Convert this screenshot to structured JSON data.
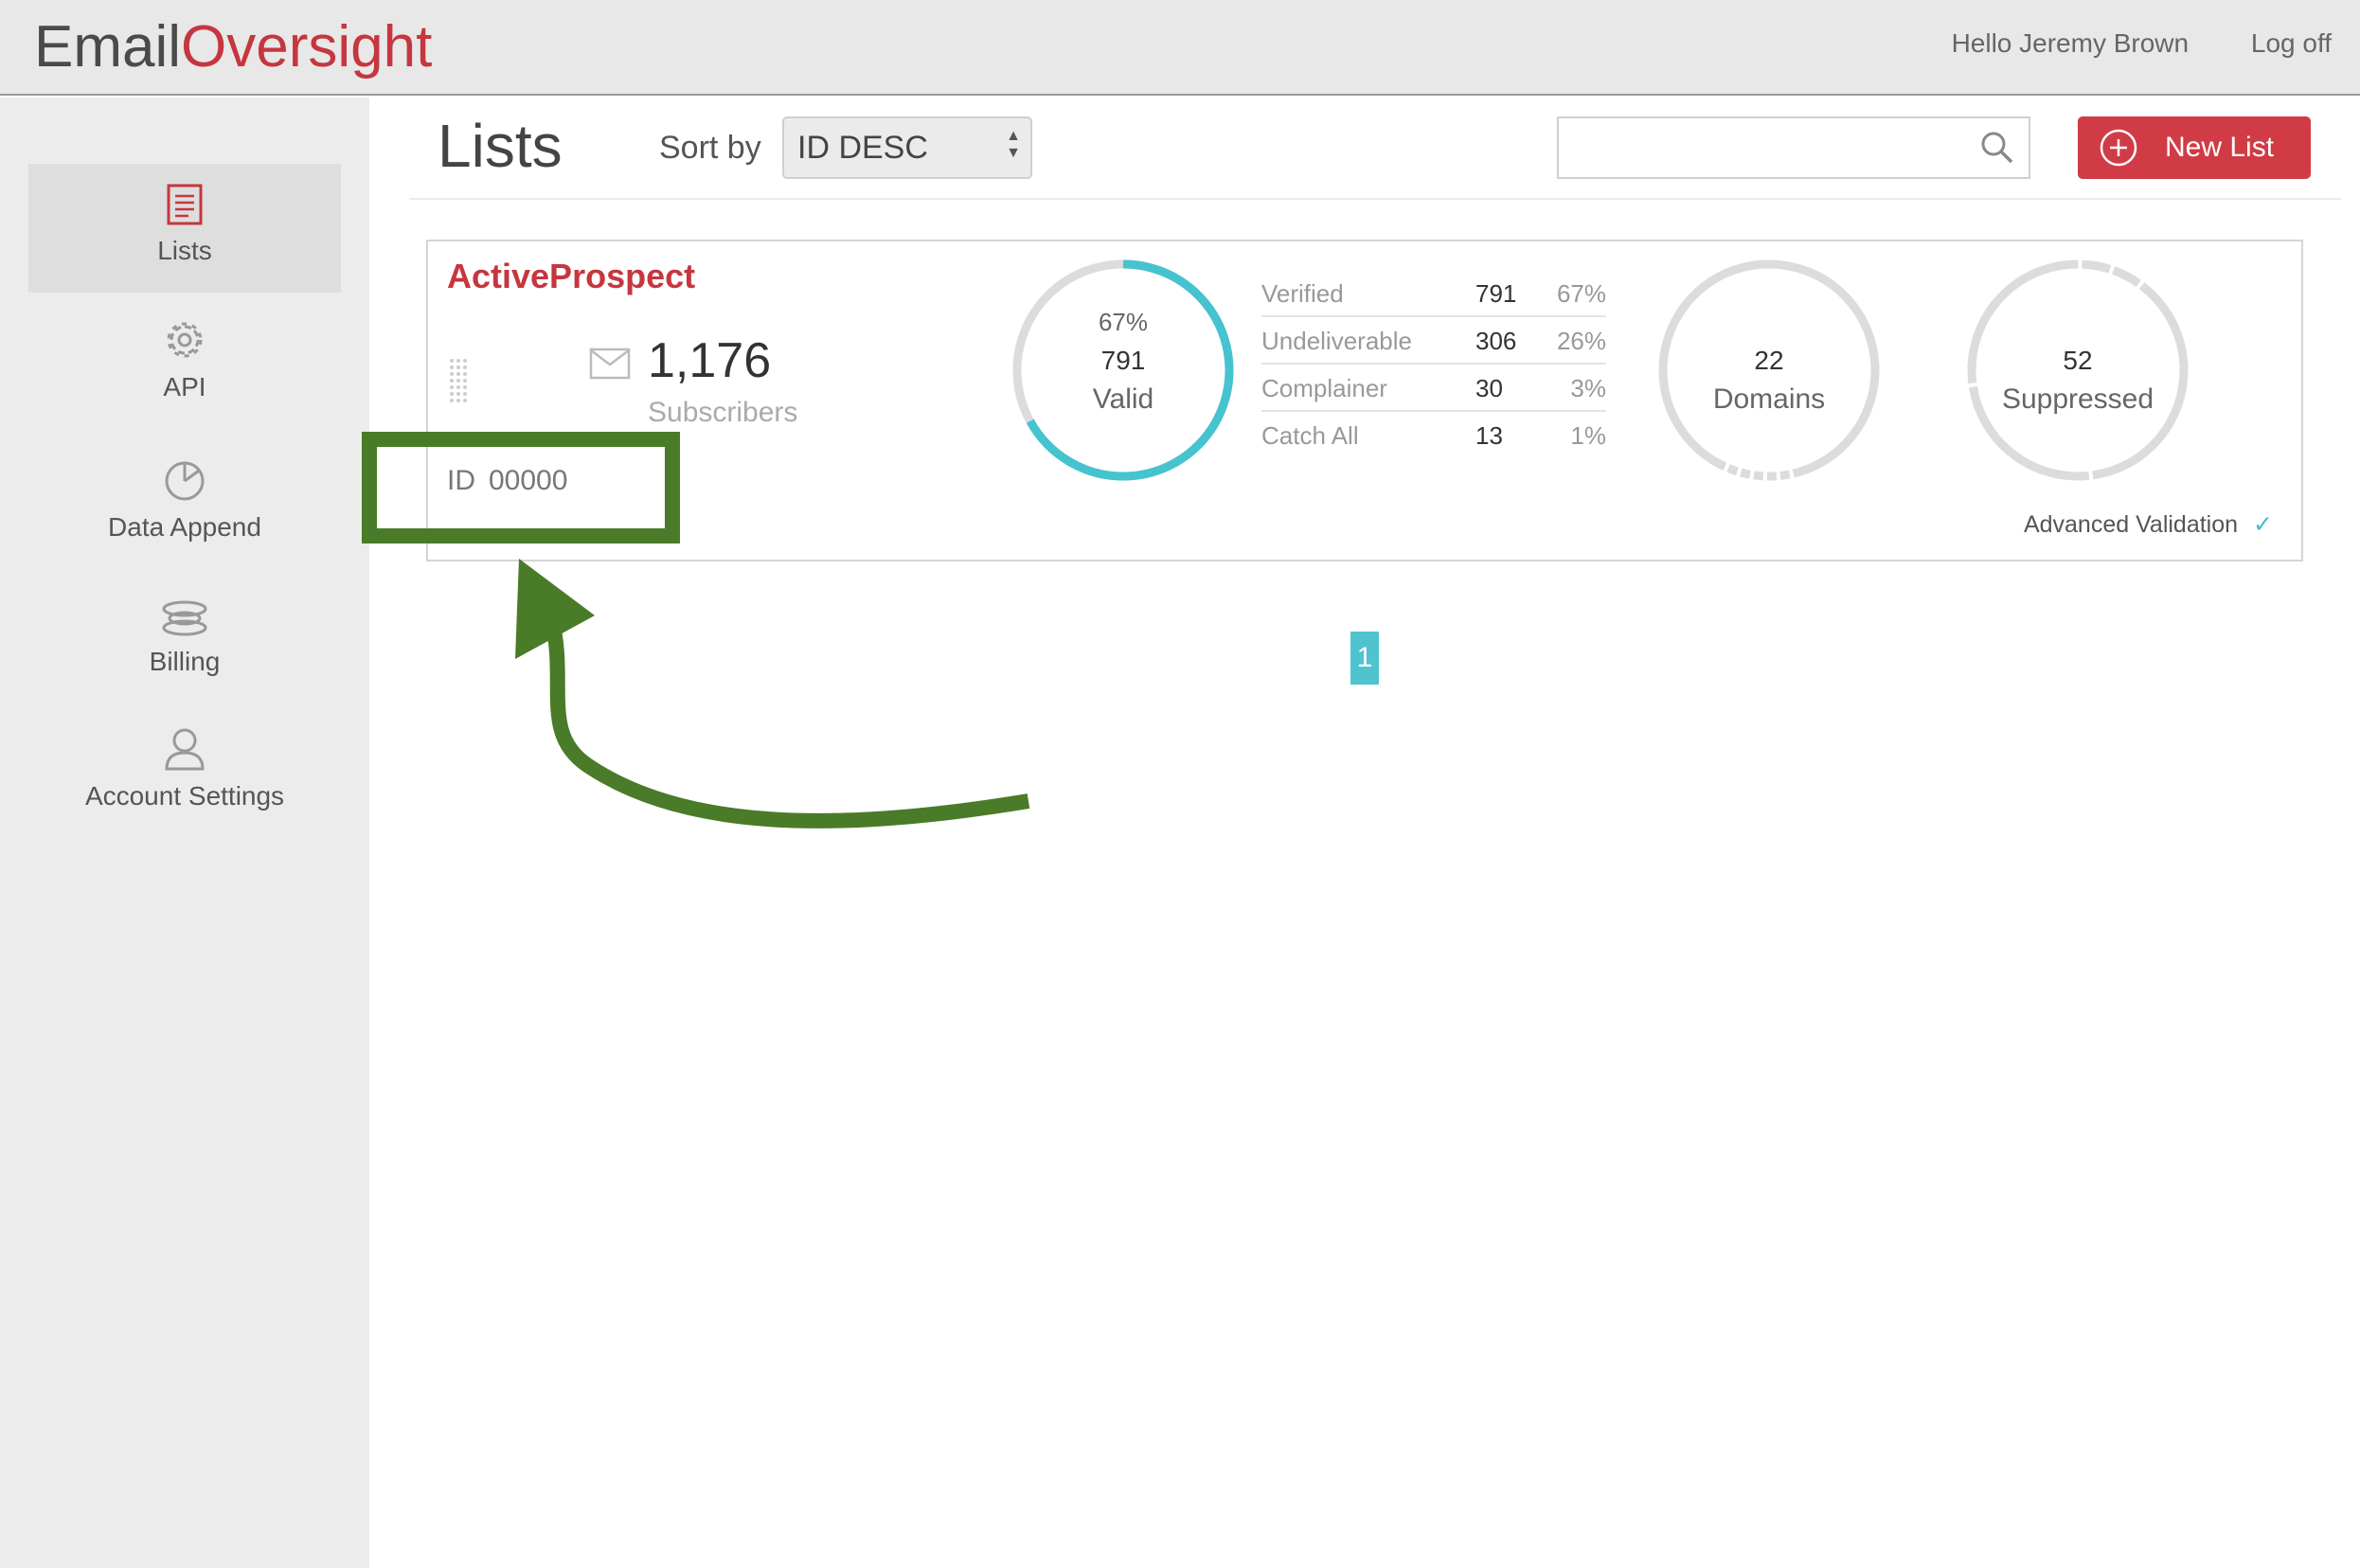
{
  "header": {
    "logo_part1": "Email",
    "logo_part2": "Oversight",
    "greeting": "Hello Jeremy Brown",
    "logoff": "Log off"
  },
  "sidebar": {
    "items": [
      {
        "label": "Lists",
        "icon": "document-icon",
        "active": true
      },
      {
        "label": "API",
        "icon": "gear-icon"
      },
      {
        "label": "Data Append",
        "icon": "pie-chart-icon"
      },
      {
        "label": "Billing",
        "icon": "coins-icon"
      },
      {
        "label": "Account Settings",
        "icon": "user-icon"
      }
    ]
  },
  "toolbar": {
    "title": "Lists",
    "sort_label": "Sort by",
    "sort_value": "ID DESC",
    "search_placeholder": "",
    "new_list_label": "New List"
  },
  "list_card": {
    "name": "ActiveProspect",
    "subscriber_count": "1,176",
    "subscriber_label": "Subscribers",
    "id_label": "ID",
    "id_value": "00000",
    "valid_ring": {
      "percent_text": "67%",
      "count": "791",
      "label": "Valid",
      "fraction": 0.67
    },
    "stats": [
      {
        "name": "Verified",
        "count": "791",
        "percent": "67%"
      },
      {
        "name": "Undeliverable",
        "count": "306",
        "percent": "26%"
      },
      {
        "name": "Complainer",
        "count": "30",
        "percent": "3%"
      },
      {
        "name": "Catch All",
        "count": "13",
        "percent": "1%"
      }
    ],
    "domains": {
      "count": "22",
      "label": "Domains"
    },
    "suppressed": {
      "count": "52",
      "label": "Suppressed"
    },
    "advanced_validation": "Advanced Validation"
  },
  "pagination": {
    "current": "1"
  },
  "colors": {
    "brand_red": "#c6363f",
    "accent_teal": "#45c3cf",
    "annotation_green": "#4a7b28"
  }
}
